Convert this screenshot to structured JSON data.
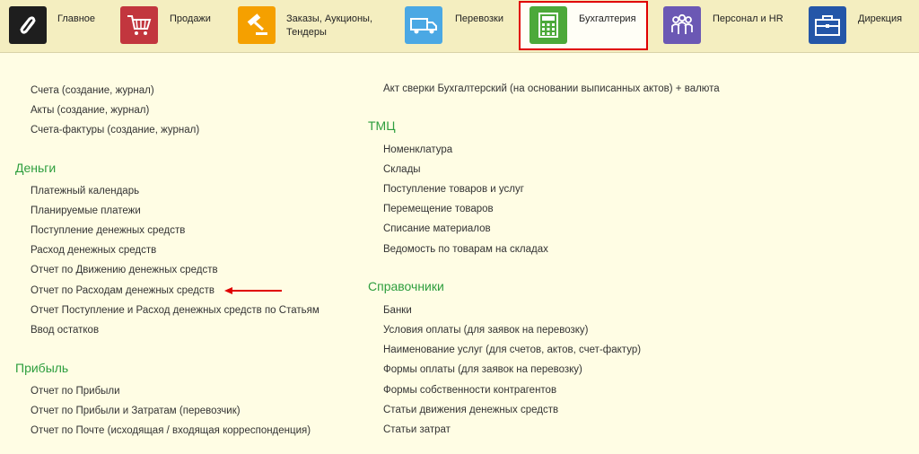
{
  "nav": {
    "items": [
      {
        "label": "Главное",
        "icon": "logo-icon",
        "color": "#1e1e1e"
      },
      {
        "label": "Продажи",
        "icon": "cart-icon",
        "color": "#c2363e"
      },
      {
        "label": "Заказы,  Аукционы, Тендеры",
        "icon": "gavel-icon",
        "color": "#f5a000"
      },
      {
        "label": "Перевозки",
        "icon": "truck-icon",
        "color": "#4aa8e4"
      },
      {
        "label": "Бухгалтерия",
        "icon": "calculator-icon",
        "color": "#4ca93a"
      },
      {
        "label": "Персонал и HR",
        "icon": "people-icon",
        "color": "#6b58b4"
      },
      {
        "label": "Дирекция",
        "icon": "briefcase-icon",
        "color": "#2456a8"
      }
    ],
    "active_index": 4,
    "highlight_color": "#e00000"
  },
  "left_column": {
    "top_links": [
      "Счета (создание, журнал)",
      "Акты (создание, журнал)",
      "Счета-фактуры (создание, журнал)"
    ],
    "sections": [
      {
        "title": "Деньги",
        "links": [
          "Платежный календарь",
          "Планируемые платежи",
          "Поступление денежных средств",
          "Расход денежных средств",
          "Отчет по Движению денежных средств",
          "Отчет по Расходам денежных средств",
          "Отчет Поступление и Расход денежных средств по Статьям",
          "Ввод остатков"
        ]
      },
      {
        "title": "Прибыль",
        "links": [
          "Отчет по Прибыли",
          "Отчет по Прибыли и Затратам (перевозчик)",
          "Отчет по Почте (исходящая / входящая корреспонденция)"
        ]
      }
    ]
  },
  "right_column": {
    "top_links": [
      "Акт сверки Бухгалтерский (на основании выписанных актов) + валюта"
    ],
    "sections": [
      {
        "title": "ТМЦ",
        "links": [
          "Номенклатура",
          "Склады",
          "Поступление товаров и услуг",
          "Перемещение товаров",
          "Списание материалов",
          "Ведомость по товарам на складах"
        ]
      },
      {
        "title": "Справочники",
        "links": [
          "Банки",
          "Условия оплаты (для заявок на перевозку)",
          "Наименование услуг (для счетов, актов, счет-фактур)",
          "Формы оплаты (для заявок на перевозку)",
          "Формы собственности контрагентов",
          "Статьи движения денежных средств",
          "Статьи затрат"
        ]
      }
    ]
  },
  "annotation": {
    "arrow_color": "#e00000",
    "target": "Отчет по Расходам денежных средств"
  }
}
